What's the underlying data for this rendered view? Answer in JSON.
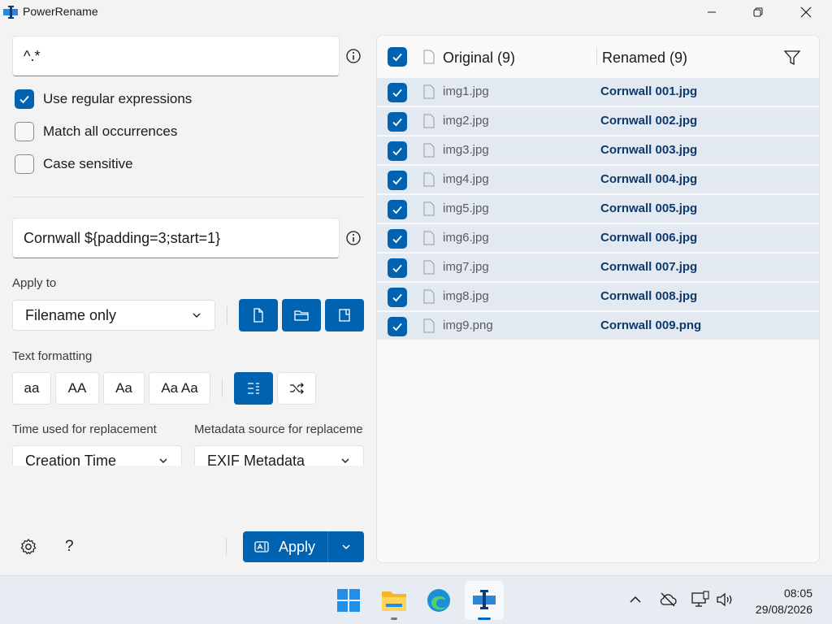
{
  "window": {
    "title": "PowerRename"
  },
  "search": {
    "value": "^.*"
  },
  "options": [
    {
      "label": "Use regular expressions",
      "checked": true
    },
    {
      "label": "Match all occurrences",
      "checked": false
    },
    {
      "label": "Case sensitive",
      "checked": false
    }
  ],
  "replace": {
    "value": "Cornwall ${padding=3;start=1}"
  },
  "apply_to": {
    "label": "Apply to",
    "selected": "Filename only"
  },
  "text_formatting": {
    "label": "Text formatting",
    "buttons": [
      "aa",
      "AA",
      "Aa",
      "Aa Aa"
    ]
  },
  "time": {
    "label": "Time used for replacement",
    "selected": "Creation Time"
  },
  "metadata": {
    "label": "Metadata source for replaceme",
    "selected": "EXIF Metadata"
  },
  "apply_button": {
    "label": "Apply"
  },
  "help_button": {
    "label": "?"
  },
  "list": {
    "original_header": "Original (9)",
    "renamed_header": "Renamed (9)",
    "rows": [
      {
        "original": "img1.jpg",
        "renamed": "Cornwall 001.jpg"
      },
      {
        "original": "img2.jpg",
        "renamed": "Cornwall 002.jpg"
      },
      {
        "original": "img3.jpg",
        "renamed": "Cornwall 003.jpg"
      },
      {
        "original": "img4.jpg",
        "renamed": "Cornwall 004.jpg"
      },
      {
        "original": "img5.jpg",
        "renamed": "Cornwall 005.jpg"
      },
      {
        "original": "img6.jpg",
        "renamed": "Cornwall 006.jpg"
      },
      {
        "original": "img7.jpg",
        "renamed": "Cornwall 007.jpg"
      },
      {
        "original": "img8.jpg",
        "renamed": "Cornwall 008.jpg"
      },
      {
        "original": "img9.png",
        "renamed": "Cornwall 009.png"
      }
    ]
  },
  "taskbar": {
    "time": "08:05",
    "date": "29/08/2026"
  },
  "colors": {
    "accent": "#0063b1",
    "row_bg": "#e3e9f1",
    "renamed_text": "#0f3a6e"
  }
}
